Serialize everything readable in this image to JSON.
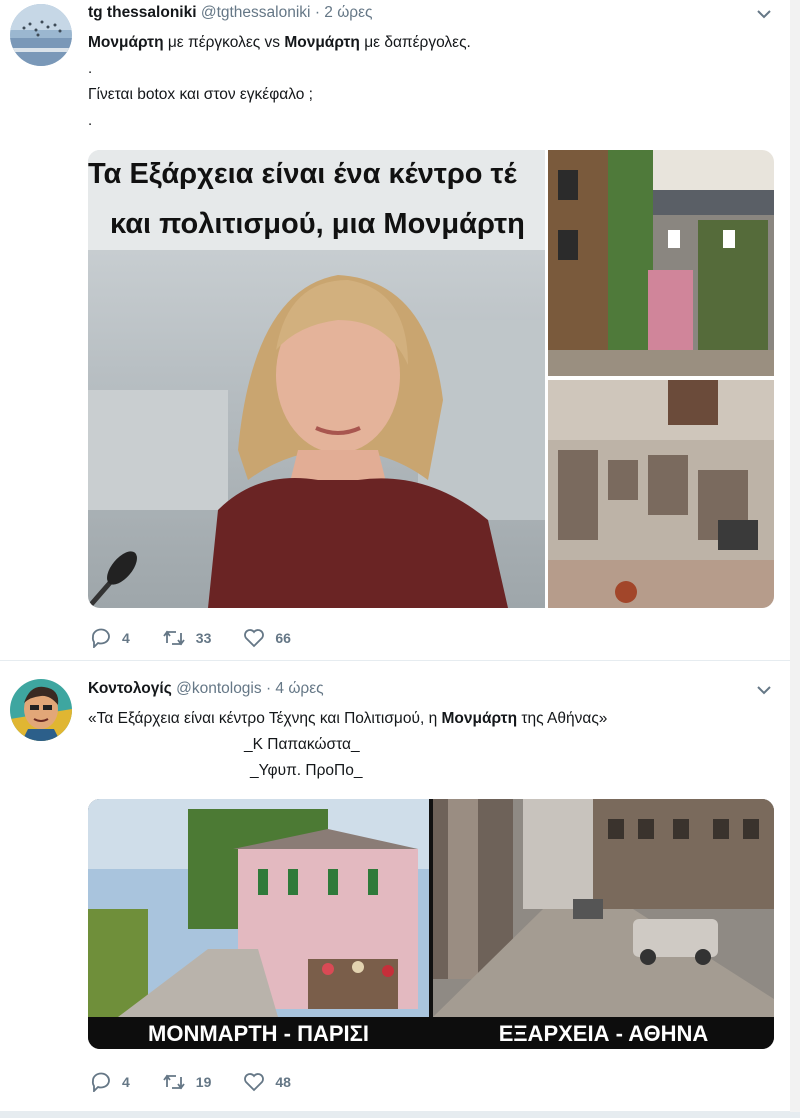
{
  "tweets": [
    {
      "author": "tg thessaloniki",
      "handle": "@tgthessaloniki",
      "time": "· 2 ώρες",
      "line1_bold_a": "Μονμάρτη",
      "line1_mid": " με πέργκολες vs ",
      "line1_bold_b": "Μονμάρτη",
      "line1_end": " με δαπέργολες.",
      "dot1": ".",
      "line2": "Γίνεται botox και στον εγκέφαλο ;",
      "dot2": ".",
      "image_caption_1": "Τα Εξάρχεια είναι ένα κέντρο τέ",
      "image_caption_2": "και πολιτισμού, μια Μονμάρτη",
      "replies": "4",
      "retweets": "33",
      "likes": "66"
    },
    {
      "author": "Κοντολογίς",
      "handle": "@kontologis",
      "time": "· 4 ώρες",
      "line1_start": "«Τα Εξάρχεια είναι κέντρο Τέχνης και Πολιτισμού, η ",
      "line1_bold": "Μονμάρτη",
      "line1_end": " της Αθήνας»",
      "line2": "_Κ Παπακώστα_",
      "line3": "_Υφυπ. ΠροΠο_",
      "caption_left": "ΜΟΝΜΑΡΤΗ - ΠΑΡΙΣΙ",
      "caption_right": "ΕΞΑΡΧΕΙΑ - ΑΘΗΝΑ",
      "replies": "4",
      "retweets": "19",
      "likes": "48"
    }
  ],
  "icons": {
    "reply": "reply-icon",
    "retweet": "retweet-icon",
    "like": "heart-icon",
    "more": "chevron-down-icon"
  },
  "colors": {
    "secondary_text": "#657786",
    "divider": "#e6ecf0"
  }
}
